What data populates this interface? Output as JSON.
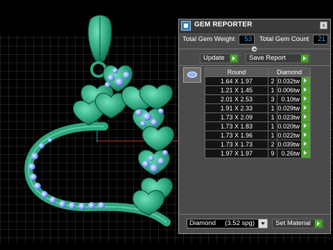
{
  "panel": {
    "title": "GEM REPORTER",
    "close_label": "x",
    "total_weight_label": "Total Gem Weight",
    "total_weight_value": "53",
    "total_count_label": "Total Gem Count",
    "total_count_value": "21",
    "update_label": "Update",
    "save_report_label": "Save Report",
    "columns": {
      "shape": "Round",
      "material": "Diamond"
    },
    "rows": [
      {
        "size": "1.64 X 1.97",
        "qty": "2",
        "weight": "0.032tw"
      },
      {
        "size": "1.21 X 1.45",
        "qty": "1",
        "weight": "0.006tw"
      },
      {
        "size": "2.01 X 2.53",
        "qty": "3",
        "weight": "0.10tw"
      },
      {
        "size": "1.91 X 2.33",
        "qty": "1",
        "weight": "0.029tw"
      },
      {
        "size": "1.73 X 2.09",
        "qty": "1",
        "weight": "0.023tw"
      },
      {
        "size": "1.73 X 1.83",
        "qty": "1",
        "weight": "0.020tw"
      },
      {
        "size": "1.73 X 1.96",
        "qty": "1",
        "weight": "0.022tw"
      },
      {
        "size": "1.73 X 1.73",
        "qty": "2",
        "weight": "0.039tw"
      },
      {
        "size": "1.97 X 1.97",
        "qty": "9",
        "weight": "0.26tw"
      }
    ],
    "material_select": "Diamond     (3.52 spg)",
    "set_material_label": "Set Material"
  },
  "colors": {
    "value_text": "#35a6ff",
    "go_arrow": "#4aa82c",
    "model_green": "#2fa87f",
    "gem_blue": "#8fb0ff",
    "axis_red": "#c0392b",
    "axis_cyan": "#1fb8c8"
  },
  "icons": {
    "app": "gem-reporter-icon",
    "close": "close-icon",
    "arrow": "play-arrow-icon",
    "dropdown": "chevron-down-icon",
    "collapse": "collapse-icon"
  }
}
